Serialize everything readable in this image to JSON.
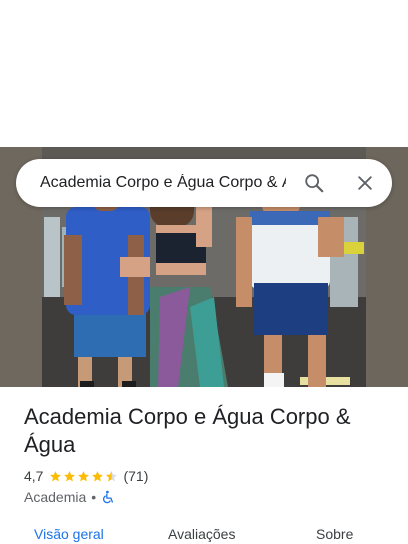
{
  "search": {
    "query": "Academia Corpo e Água Corpo & Água"
  },
  "place": {
    "title": "Academia Corpo e Água Corpo & Água",
    "rating": "4,7",
    "rating_value": 4.7,
    "review_count": "(71)",
    "category": "Academia",
    "separator": "•"
  },
  "tabs": [
    {
      "label": "Visão geral"
    },
    {
      "label": "Avaliações"
    },
    {
      "label": "Sobre"
    }
  ],
  "colors": {
    "accent": "#1a73e8",
    "star": "#fbbc04",
    "text": "#202124"
  },
  "icons": [
    "search-icon",
    "close-icon",
    "star-icon",
    "wheelchair-icon"
  ]
}
